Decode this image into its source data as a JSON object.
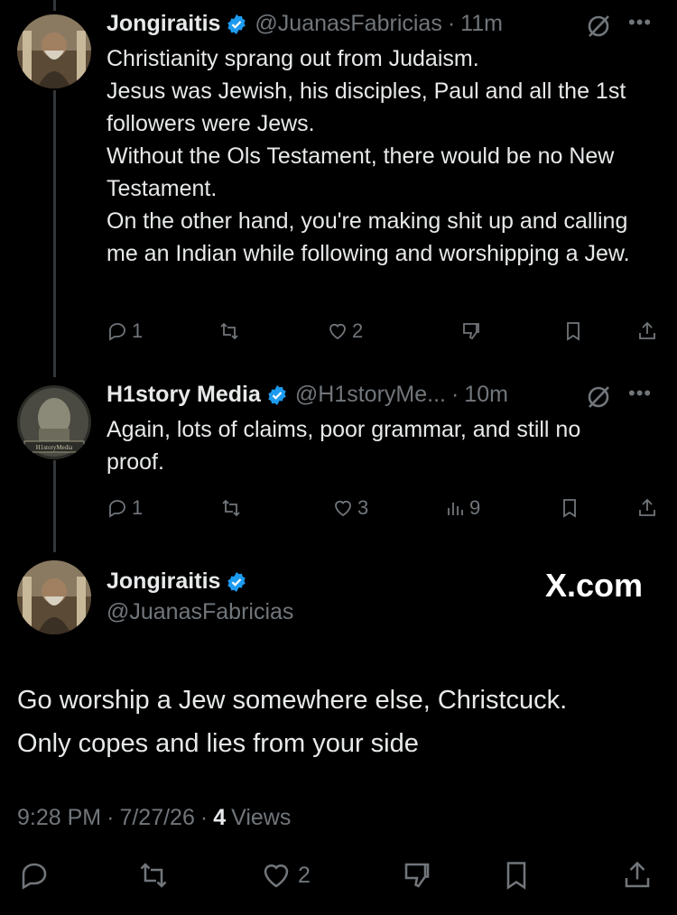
{
  "colors": {
    "verified": "#1d9bf0",
    "muted": "#71767b",
    "text": "#e7e9ea",
    "background": "#000000"
  },
  "tweets": [
    {
      "name": "Jongiraitis",
      "handle": "@JuanasFabricias",
      "time": "11m",
      "text": "Christianity sprang out from Judaism.\nJesus was Jewish, his disciples, Paul and all the 1st followers were Jews.\nWithout the Ols Testament, there would be no New Testament.\nOn the other hand, you're making shit up and calling me an Indian while following and worshippjng a Jew.",
      "replies": "1",
      "likes": "2"
    },
    {
      "name": "H1story Media",
      "handle": "@H1storyMe...",
      "time": "10m",
      "text": "Again, lots of claims, poor grammar, and still no proof.",
      "replies": "1",
      "likes": "3",
      "views": "9",
      "avatar_text": "H1storyMedia"
    }
  ],
  "main": {
    "name": "Jongiraitis",
    "handle": "@JuanasFabricias",
    "brand": "X.com",
    "text": "Go worship a Jew somewhere else, Christcuck.\nOnly copes and lies from your side",
    "time": "9:28 PM",
    "date": "7/27/26",
    "views_count": "4",
    "views_label": "Views",
    "likes": "2"
  }
}
